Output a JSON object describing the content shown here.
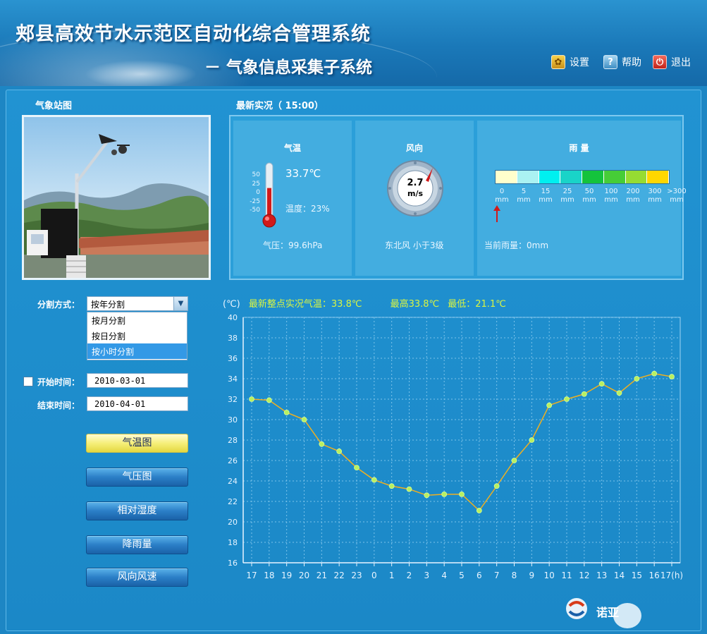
{
  "header": {
    "title": "郏县高效节水示范区自动化综合管理系统",
    "subtitle": "－ 气象信息采集子系统",
    "nav": {
      "settings": "设置",
      "help": "帮助",
      "exit": "退出"
    },
    "colors": {
      "background": "#1a78b8",
      "title_text": "#ffffff"
    }
  },
  "station": {
    "label": "气象站图"
  },
  "latest": {
    "label": "最新实况（ 15:00）",
    "temperature": {
      "title": "气温",
      "value": "33.7℃",
      "humidity": "温度：23%",
      "pressure": "气压：99.6hPa",
      "scale": [
        "50",
        "25",
        "0",
        "-25",
        "-50"
      ],
      "level_percent": 58
    },
    "wind": {
      "title": "风向",
      "speed": "2.7",
      "unit": "m/s",
      "desc": "东北风  小于3级",
      "direction_deg": 45
    },
    "rain": {
      "title": "雨 量",
      "scale_labels": [
        "0",
        "5",
        "15",
        "25",
        "50",
        "100",
        "200",
        "300",
        ">300"
      ],
      "unit": "mm",
      "current": "当前雨量：0mm",
      "colors": [
        "#ffffcc",
        "#aaf2f2",
        "#00f0f0",
        "#19d4c8",
        "#14c33c",
        "#46cd37",
        "#96dc32",
        "#ffd700"
      ],
      "indicator_index": 0
    }
  },
  "form": {
    "split_label": "分割方式：",
    "split_selected": "按年分割",
    "split_options": [
      "按月分割",
      "按日分割",
      "按小时分割"
    ],
    "split_highlight_index": 2,
    "start_label": "开始时间：",
    "start_value": "2010-03-01",
    "end_label": "结束时间：",
    "end_value": "2010-04-01"
  },
  "buttons": {
    "temp": "气温图",
    "pressure": "气压图",
    "humidity": "相对湿度",
    "rain": "降雨量",
    "wind": "风向风速"
  },
  "chart_header": {
    "unit": "(℃)",
    "latest": "最新整点实况气温：33.8℃",
    "max": "最高33.8℃",
    "min": "最低：21.1℃"
  },
  "chart_data": {
    "type": "line",
    "x": [
      "17",
      "18",
      "19",
      "20",
      "21",
      "22",
      "23",
      "0",
      "1",
      "2",
      "3",
      "4",
      "5",
      "6",
      "7",
      "8",
      "9",
      "10",
      "11",
      "12",
      "13",
      "14",
      "15",
      "16",
      "17(h)"
    ],
    "values": [
      32.0,
      31.9,
      30.7,
      30.0,
      27.6,
      26.9,
      25.3,
      24.1,
      23.5,
      23.2,
      22.6,
      22.7,
      22.7,
      21.1,
      23.5,
      26.0,
      28.0,
      31.4,
      32.0,
      32.5,
      33.5,
      32.6,
      34.0,
      34.5,
      34.2
    ],
    "ylim": [
      16,
      40
    ],
    "yticks": [
      16,
      18,
      20,
      22,
      24,
      26,
      28,
      30,
      32,
      34,
      36,
      38,
      40
    ],
    "ylabel": "(℃)",
    "grid": true,
    "line_color": "#f0b020",
    "point_color": "#b8f060"
  },
  "footer": {
    "logo_text": "诺亚"
  }
}
